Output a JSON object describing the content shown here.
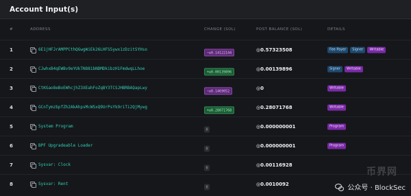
{
  "header": {
    "title": "Account Input(s)"
  },
  "columns": {
    "num": "#",
    "address": "ADDRESS",
    "change": "CHANGE (SOL)",
    "post_balance": "POST BALANCE (SOL)",
    "details": "DETAILS"
  },
  "rows": [
    {
      "num": "1",
      "address": "6E1jHFJrAMPPCthQGwgWiEk26LHFS5ywx1zDzitSYHso",
      "change": "−◎0.14122144",
      "change_kind": "neg",
      "post": "◎0.57323508",
      "tags": [
        {
          "label": "Fee Payer",
          "kind": "blue"
        },
        {
          "label": "Signer",
          "kind": "blue"
        },
        {
          "label": "Writable",
          "kind": "purple"
        }
      ]
    },
    {
      "num": "2",
      "address": "CJwhxB4qEWBv9eYUkTN881bNDMDkibzH1FmdwqLLhoe",
      "change": "+◎0.00139896",
      "change_kind": "pos",
      "post": "◎0.00139896",
      "tags": [
        {
          "label": "Signer",
          "kind": "blue"
        },
        {
          "label": "Writable",
          "kind": "purple"
        }
      ]
    },
    {
      "num": "3",
      "address": "CtKGao8eBoEWhcjhZ3XEahFoZqBY3TCSJHBRBAQapLwy",
      "change": "−◎0.1469052",
      "change_kind": "neg",
      "post": "◎0",
      "tags": [
        {
          "label": "Writable",
          "kind": "purple"
        }
      ]
    },
    {
      "num": "4",
      "address": "GCnTymzbpfZh2AkAhpsMcWSxQ9UrPsYk9riTi2QjMywg",
      "change": "+◎0.28071768",
      "change_kind": "pos",
      "post": "◎0.28071768",
      "tags": [
        {
          "label": "Writable",
          "kind": "purple"
        }
      ]
    },
    {
      "num": "5",
      "address": "System Program",
      "change": "0",
      "change_kind": "zero",
      "post": "◎0.000000001",
      "tags": [
        {
          "label": "Program",
          "kind": "purple"
        }
      ]
    },
    {
      "num": "6",
      "address": "BPF Upgradeable Loader",
      "change": "0",
      "change_kind": "zero",
      "post": "◎0.000000001",
      "tags": [
        {
          "label": "Program",
          "kind": "purple"
        }
      ]
    },
    {
      "num": "7",
      "address": "Sysvar: Clock",
      "change": "0",
      "change_kind": "zero",
      "post": "◎0.00116928",
      "tags": []
    },
    {
      "num": "8",
      "address": "Sysvar: Rent",
      "change": "0",
      "change_kind": "zero",
      "post": "◎0.0010092",
      "tags": []
    }
  ],
  "watermark": {
    "text": "公众号 · BlockSec",
    "brand": "币界网"
  },
  "colors": {
    "accent": "#2fd0b5",
    "negative": "#5b2b73",
    "positive": "#1e5a36",
    "tag_blue": "#1f4a6e",
    "tag_purple": "#7a2aa6"
  }
}
